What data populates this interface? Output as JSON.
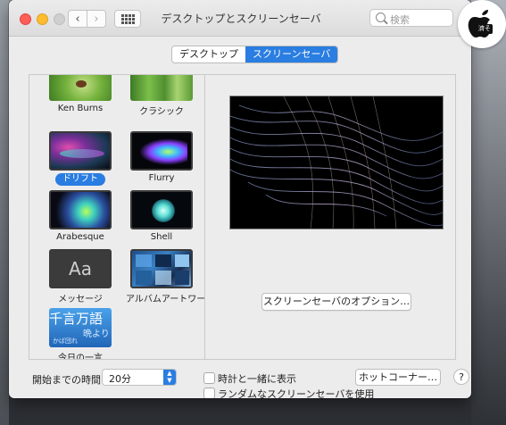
{
  "window": {
    "title": "デスクトップとスクリーンセーバ",
    "search_placeholder": "検索"
  },
  "tabs": [
    {
      "label": "デスクトップ",
      "selected": false
    },
    {
      "label": "スクリーンセーバ",
      "selected": true
    }
  ],
  "savers": [
    {
      "label": "Ken Burns",
      "selected": false
    },
    {
      "label": "クラシック",
      "selected": false
    },
    {
      "label": "ドリフト",
      "selected": true
    },
    {
      "label": "Flurry",
      "selected": false
    },
    {
      "label": "Arabesque",
      "selected": false
    },
    {
      "label": "Shell",
      "selected": false
    },
    {
      "label": "メッセージ",
      "selected": false
    },
    {
      "label": "アルバムアートワーク",
      "selected": false
    },
    {
      "label": "今日の一言",
      "selected": false
    }
  ],
  "thumb_text": {
    "message": "Aa",
    "word_line1": "千言万語",
    "word_line2": "晩より",
    "word_line3": "かば団れ"
  },
  "options_button": "スクリーンセーバのオプション…",
  "bottom": {
    "start_label": "開始までの時間:",
    "start_value": "20分",
    "show_clock": "時計と一緒に表示",
    "random_saver": "ランダムなスクリーンセーバを使用",
    "hot_corners": "ホットコーナー…",
    "help": "?"
  },
  "logo_text": "濟そ",
  "colors": {
    "accent": "#2a7de1",
    "close": "#fd5e57",
    "minimize": "#febc2e"
  }
}
